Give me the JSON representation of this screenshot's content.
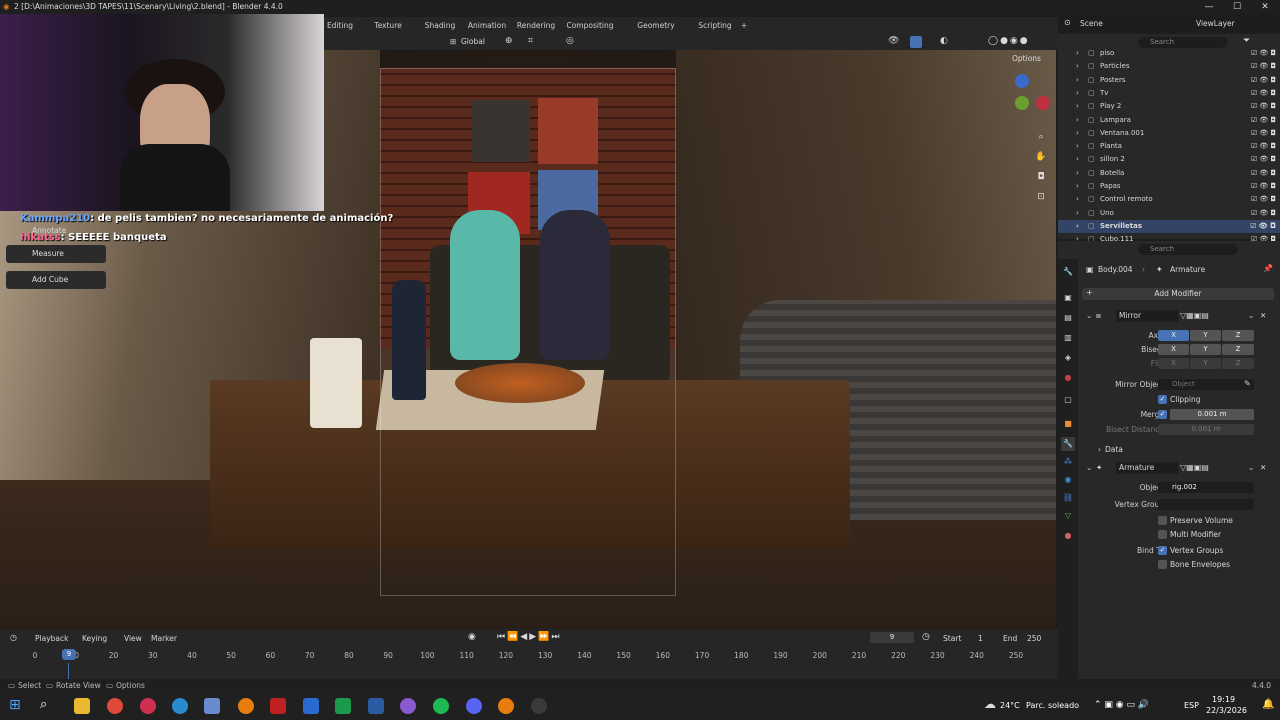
{
  "window": {
    "title": "2 [D:\\Animaciones\\3D TAPES\\11\\Scenary\\Living\\2.blend] - Blender 4.4.0",
    "controls": [
      "—",
      "☐",
      "✕"
    ]
  },
  "workspaces": [
    "Editing",
    "Texture Paint",
    "Shading",
    "Animation",
    "Rendering",
    "Compositing",
    "Geometry Nodes",
    "Scripting",
    "+"
  ],
  "viewport_header": {
    "orientation": "Global",
    "options_label": "Options"
  },
  "chat": [
    {
      "user": "Kammpa210",
      "msg": "de pelis tambien? no necesariamente de animación?"
    },
    {
      "user": "hikatss",
      "msg": "SEEEEE banqueta"
    }
  ],
  "tools": [
    "Annotate",
    "Measure",
    "Add Cube"
  ],
  "outliner": {
    "scene": "Scene",
    "view_layer": "ViewLayer",
    "search_placeholder": "Search",
    "items": [
      "piso",
      "Particles",
      "Posters",
      "Tv",
      "Play 2",
      "Lampara",
      "Ventana.001",
      "Planta",
      "sillon 2",
      "Botella",
      "Papas",
      "Control remoto",
      "Uno",
      "Servilletas",
      "Cubo.111"
    ]
  },
  "properties": {
    "search_placeholder": "Search",
    "object": "Body.004",
    "data": "Armature",
    "add_modifier": "Add Modifier",
    "mirror": {
      "name": "Mirror",
      "axis_label": "Axis",
      "bisect_label": "Bisect",
      "flip_label": "Flip",
      "axes": [
        "X",
        "Y",
        "Z"
      ],
      "mirror_object_label": "Mirror Object",
      "mirror_object_placeholder": "Object",
      "clipping": "Clipping",
      "merge_label": "Merge",
      "merge_value": "0.001 m",
      "bisect_distance_label": "Bisect Distance",
      "bisect_distance_value": "0.001 m",
      "data_label": "Data"
    },
    "armature": {
      "name": "Armature",
      "object_label": "Object",
      "object_value": "rig.002",
      "vertex_group_label": "Vertex Group",
      "preserve_volume": "Preserve Volume",
      "multi_modifier": "Multi Modifier",
      "bind_to_label": "Bind To",
      "vertex_groups": "Vertex Groups",
      "bone_envelopes": "Bone Envelopes"
    }
  },
  "timeline": {
    "menus": [
      "Playback",
      "Keying",
      "View",
      "Marker"
    ],
    "current_frame": "9",
    "start_label": "Start",
    "start": "1",
    "end_label": "End",
    "end": "250",
    "ticks": [
      "0",
      "10",
      "20",
      "30",
      "40",
      "50",
      "60",
      "70",
      "80",
      "90",
      "100",
      "110",
      "120",
      "130",
      "140",
      "150",
      "160",
      "170",
      "180",
      "190",
      "200",
      "210",
      "220",
      "230",
      "240",
      "250"
    ]
  },
  "statusbar": {
    "select": "Select",
    "rotate": "Rotate View",
    "options": "Options",
    "version": "4.4.0"
  },
  "taskbar": {
    "weather_temp": "24°C",
    "weather_desc": "Parc. soleado",
    "lang": "ESP",
    "time": "19:19",
    "date": "22/3/2026"
  }
}
